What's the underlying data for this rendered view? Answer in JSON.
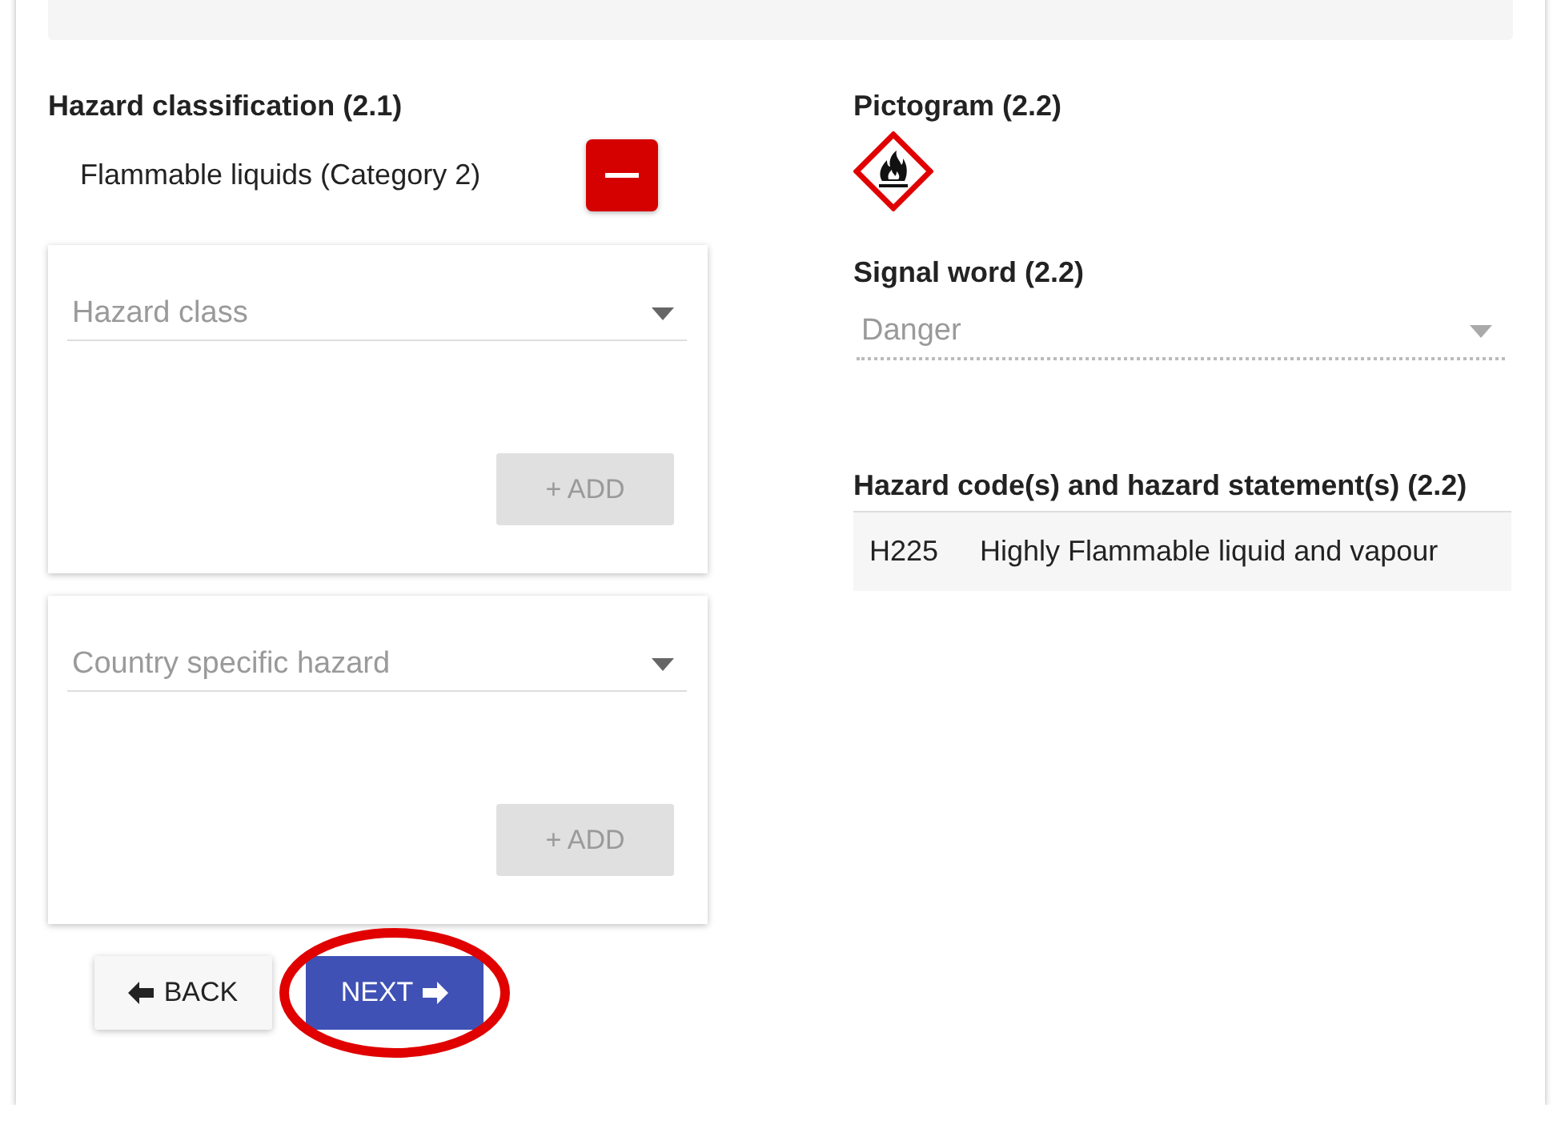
{
  "hazard_classification": {
    "title": "Hazard classification (2.1)",
    "items": [
      {
        "label": "Flammable liquids (Category 2)"
      }
    ]
  },
  "panels": [
    {
      "select_placeholder": "Hazard class",
      "add_button": "+ ADD",
      "add_disabled": true
    },
    {
      "select_placeholder": "Country specific hazard",
      "add_button": "+ ADD",
      "add_disabled": true
    }
  ],
  "pictogram": {
    "title": "Pictogram (2.2)",
    "kind": "flame"
  },
  "signal_word": {
    "title": "Signal word (2.2)",
    "value": "Danger",
    "disabled": true
  },
  "hazard_statements": {
    "title": "Hazard code(s) and hazard statement(s) (2.2)",
    "rows": [
      {
        "code": "H225",
        "statement": "Highly Flammable liquid and vapour"
      }
    ]
  },
  "navigation": {
    "back": "BACK",
    "next": "NEXT",
    "next_highlighted": true
  }
}
